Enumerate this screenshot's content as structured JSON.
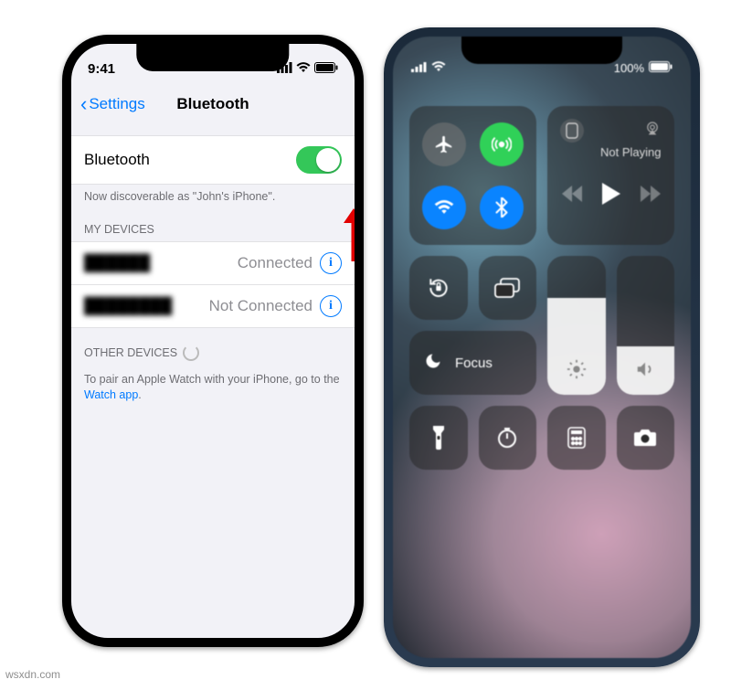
{
  "left_phone": {
    "status": {
      "time": "9:41"
    },
    "nav": {
      "back_label": "Settings",
      "title": "Bluetooth"
    },
    "bluetooth": {
      "label": "Bluetooth",
      "enabled": true,
      "discoverable_text": "Now discoverable as \"John's iPhone\"."
    },
    "my_devices_header": "MY DEVICES",
    "devices": [
      {
        "name": "██████",
        "status": "Connected"
      },
      {
        "name": "████████",
        "status": "Not Connected"
      }
    ],
    "other_devices_header": "OTHER DEVICES",
    "watch_hint_pre": "To pair an Apple Watch with your iPhone, go to the ",
    "watch_hint_link": "Watch app",
    "watch_hint_post": "."
  },
  "right_phone": {
    "status": {
      "battery_text": "100%"
    },
    "media": {
      "title": "Not Playing"
    },
    "focus_label": "Focus",
    "brightness_pct": 70,
    "volume_pct": 35,
    "connectivity": {
      "airplane": false,
      "cellular": true,
      "wifi": true,
      "bluetooth": true
    }
  },
  "watermark": "wsxdn.com"
}
